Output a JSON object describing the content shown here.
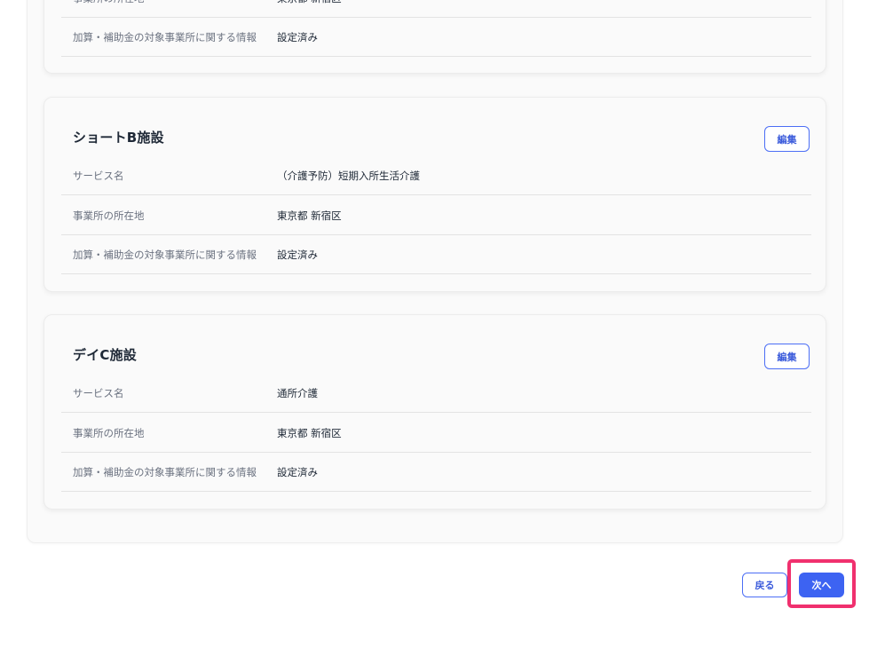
{
  "top_card": {
    "rows": [
      {
        "label": "事業所の所在地",
        "value": "東京都 新宿区"
      },
      {
        "label": "加算・補助金の対象事業所に関する情報",
        "value": "設定済み"
      }
    ]
  },
  "facilities": [
    {
      "title": "ショートB施設",
      "edit_label": "編集",
      "rows": [
        {
          "label": "サービス名",
          "value": "（介護予防）短期入所生活介護"
        },
        {
          "label": "事業所の所在地",
          "value": "東京都 新宿区"
        },
        {
          "label": "加算・補助金の対象事業所に関する情報",
          "value": "設定済み"
        }
      ]
    },
    {
      "title": "デイC施設",
      "edit_label": "編集",
      "rows": [
        {
          "label": "サービス名",
          "value": "通所介護"
        },
        {
          "label": "事業所の所在地",
          "value": "東京都 新宿区"
        },
        {
          "label": "加算・補助金の対象事業所に関する情報",
          "value": "設定済み"
        }
      ]
    }
  ],
  "footer": {
    "back_label": "戻る",
    "next_label": "次へ"
  },
  "colors": {
    "accent": "#3d63f2",
    "highlight": "#f0306e"
  }
}
